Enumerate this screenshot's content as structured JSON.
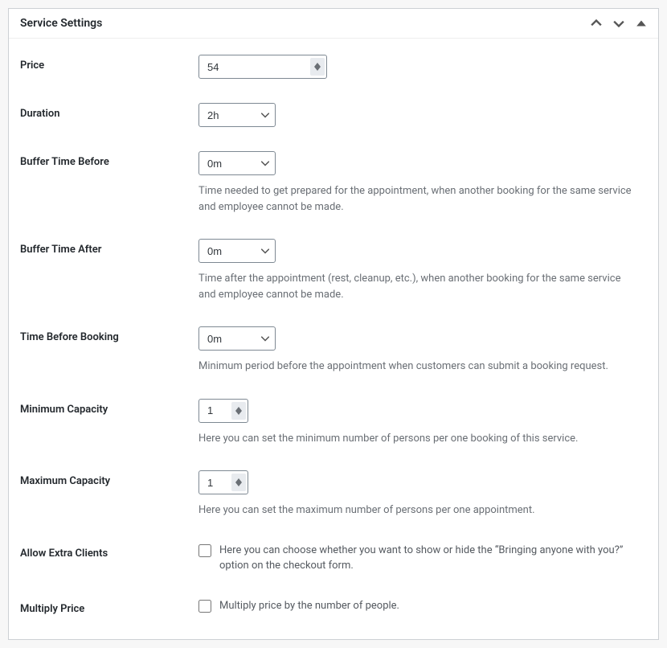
{
  "panel": {
    "title": "Service Settings"
  },
  "fields": {
    "price": {
      "label": "Price",
      "value": "54"
    },
    "duration": {
      "label": "Duration",
      "value": "2h"
    },
    "bufferBefore": {
      "label": "Buffer Time Before",
      "value": "0m",
      "help": "Time needed to get prepared for the appointment, when another booking for the same service and employee cannot be made."
    },
    "bufferAfter": {
      "label": "Buffer Time After",
      "value": "0m",
      "help": "Time after the appointment (rest, cleanup, etc.), when another booking for the same service and employee cannot be made."
    },
    "timeBeforeBooking": {
      "label": "Time Before Booking",
      "value": "0m",
      "help": "Minimum period before the appointment when customers can submit a booking request."
    },
    "minCapacity": {
      "label": "Minimum Capacity",
      "value": "1",
      "help": "Here you can set the minimum number of persons per one booking of this service."
    },
    "maxCapacity": {
      "label": "Maximum Capacity",
      "value": "1",
      "help": "Here you can set the maximum number of persons per one appointment."
    },
    "allowExtra": {
      "label": "Allow Extra Clients",
      "help": "Here you can choose whether you want to show or hide the “Bringing anyone with you?” option on the checkout form."
    },
    "multiplyPrice": {
      "label": "Multiply Price",
      "help": "Multiply price by the number of people."
    }
  }
}
